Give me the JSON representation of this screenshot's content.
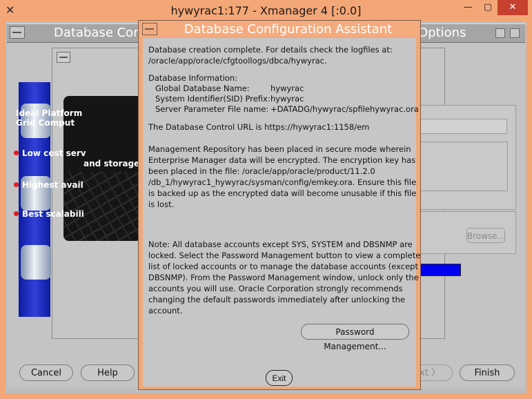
{
  "window": {
    "title": "hywyrac1:177 - Xmanager 4 [:0.0]",
    "minimize": "—",
    "maximize": "▢",
    "close": "✕"
  },
  "background_window": {
    "title_left": "Database Conf",
    "title_right": "Options",
    "promo": {
      "heading_1": "Ideal Platform",
      "heading_2": "Grid Comput",
      "item_1a": "Low cost serv",
      "item_1b": "and storage",
      "item_2": "Highest avail",
      "item_3": "Best scalabili"
    },
    "browse_label": "Browse...",
    "next_label": "xt",
    "buttons": {
      "cancel": "Cancel",
      "help": "Help",
      "finish": "Finish"
    }
  },
  "dialog": {
    "title": "Database Configuration Assistant",
    "lines": [
      "Database creation complete. For details check the logfiles at:",
      " /oracle/app/oracle/cfgtoollogs/dbca/hywyrac.",
      "Database Information:",
      "The Database Control URL is https://hywyrac1:1158/em",
      "Management Repository has been placed in secure mode wherein",
      "Enterprise Manager data will be encrypted.  The encryption key has",
      "been placed in the file: /oracle/app/oracle/product/11.2.0",
      "/db_1/hywyrac1_hywyrac/sysman/config/emkey.ora. Ensure this file",
      "is backed up as the encrypted data will become unusable if this file",
      "is lost.",
      "Note: All database accounts except SYS, SYSTEM and DBSNMP are",
      "locked. Select the Password Management button to view a complete",
      "list of locked accounts or to manage the database accounts (except",
      "DBSNMP). From the Password Management window, unlock only the",
      "accounts you will use. Oracle Corporation strongly recommends",
      "changing the default passwords immediately after unlocking the",
      "account."
    ],
    "info": [
      {
        "label": "Global Database Name:",
        "value": "hywyrac"
      },
      {
        "label": "System Identifier(SID) Prefix:",
        "value": "hywyrac"
      },
      {
        "label": "Server Parameter File name:",
        "value": "+DATADG/hywyrac/spfilehywyrac.ora"
      }
    ],
    "password_button": "Password Management...",
    "exit_button": "Exit"
  }
}
